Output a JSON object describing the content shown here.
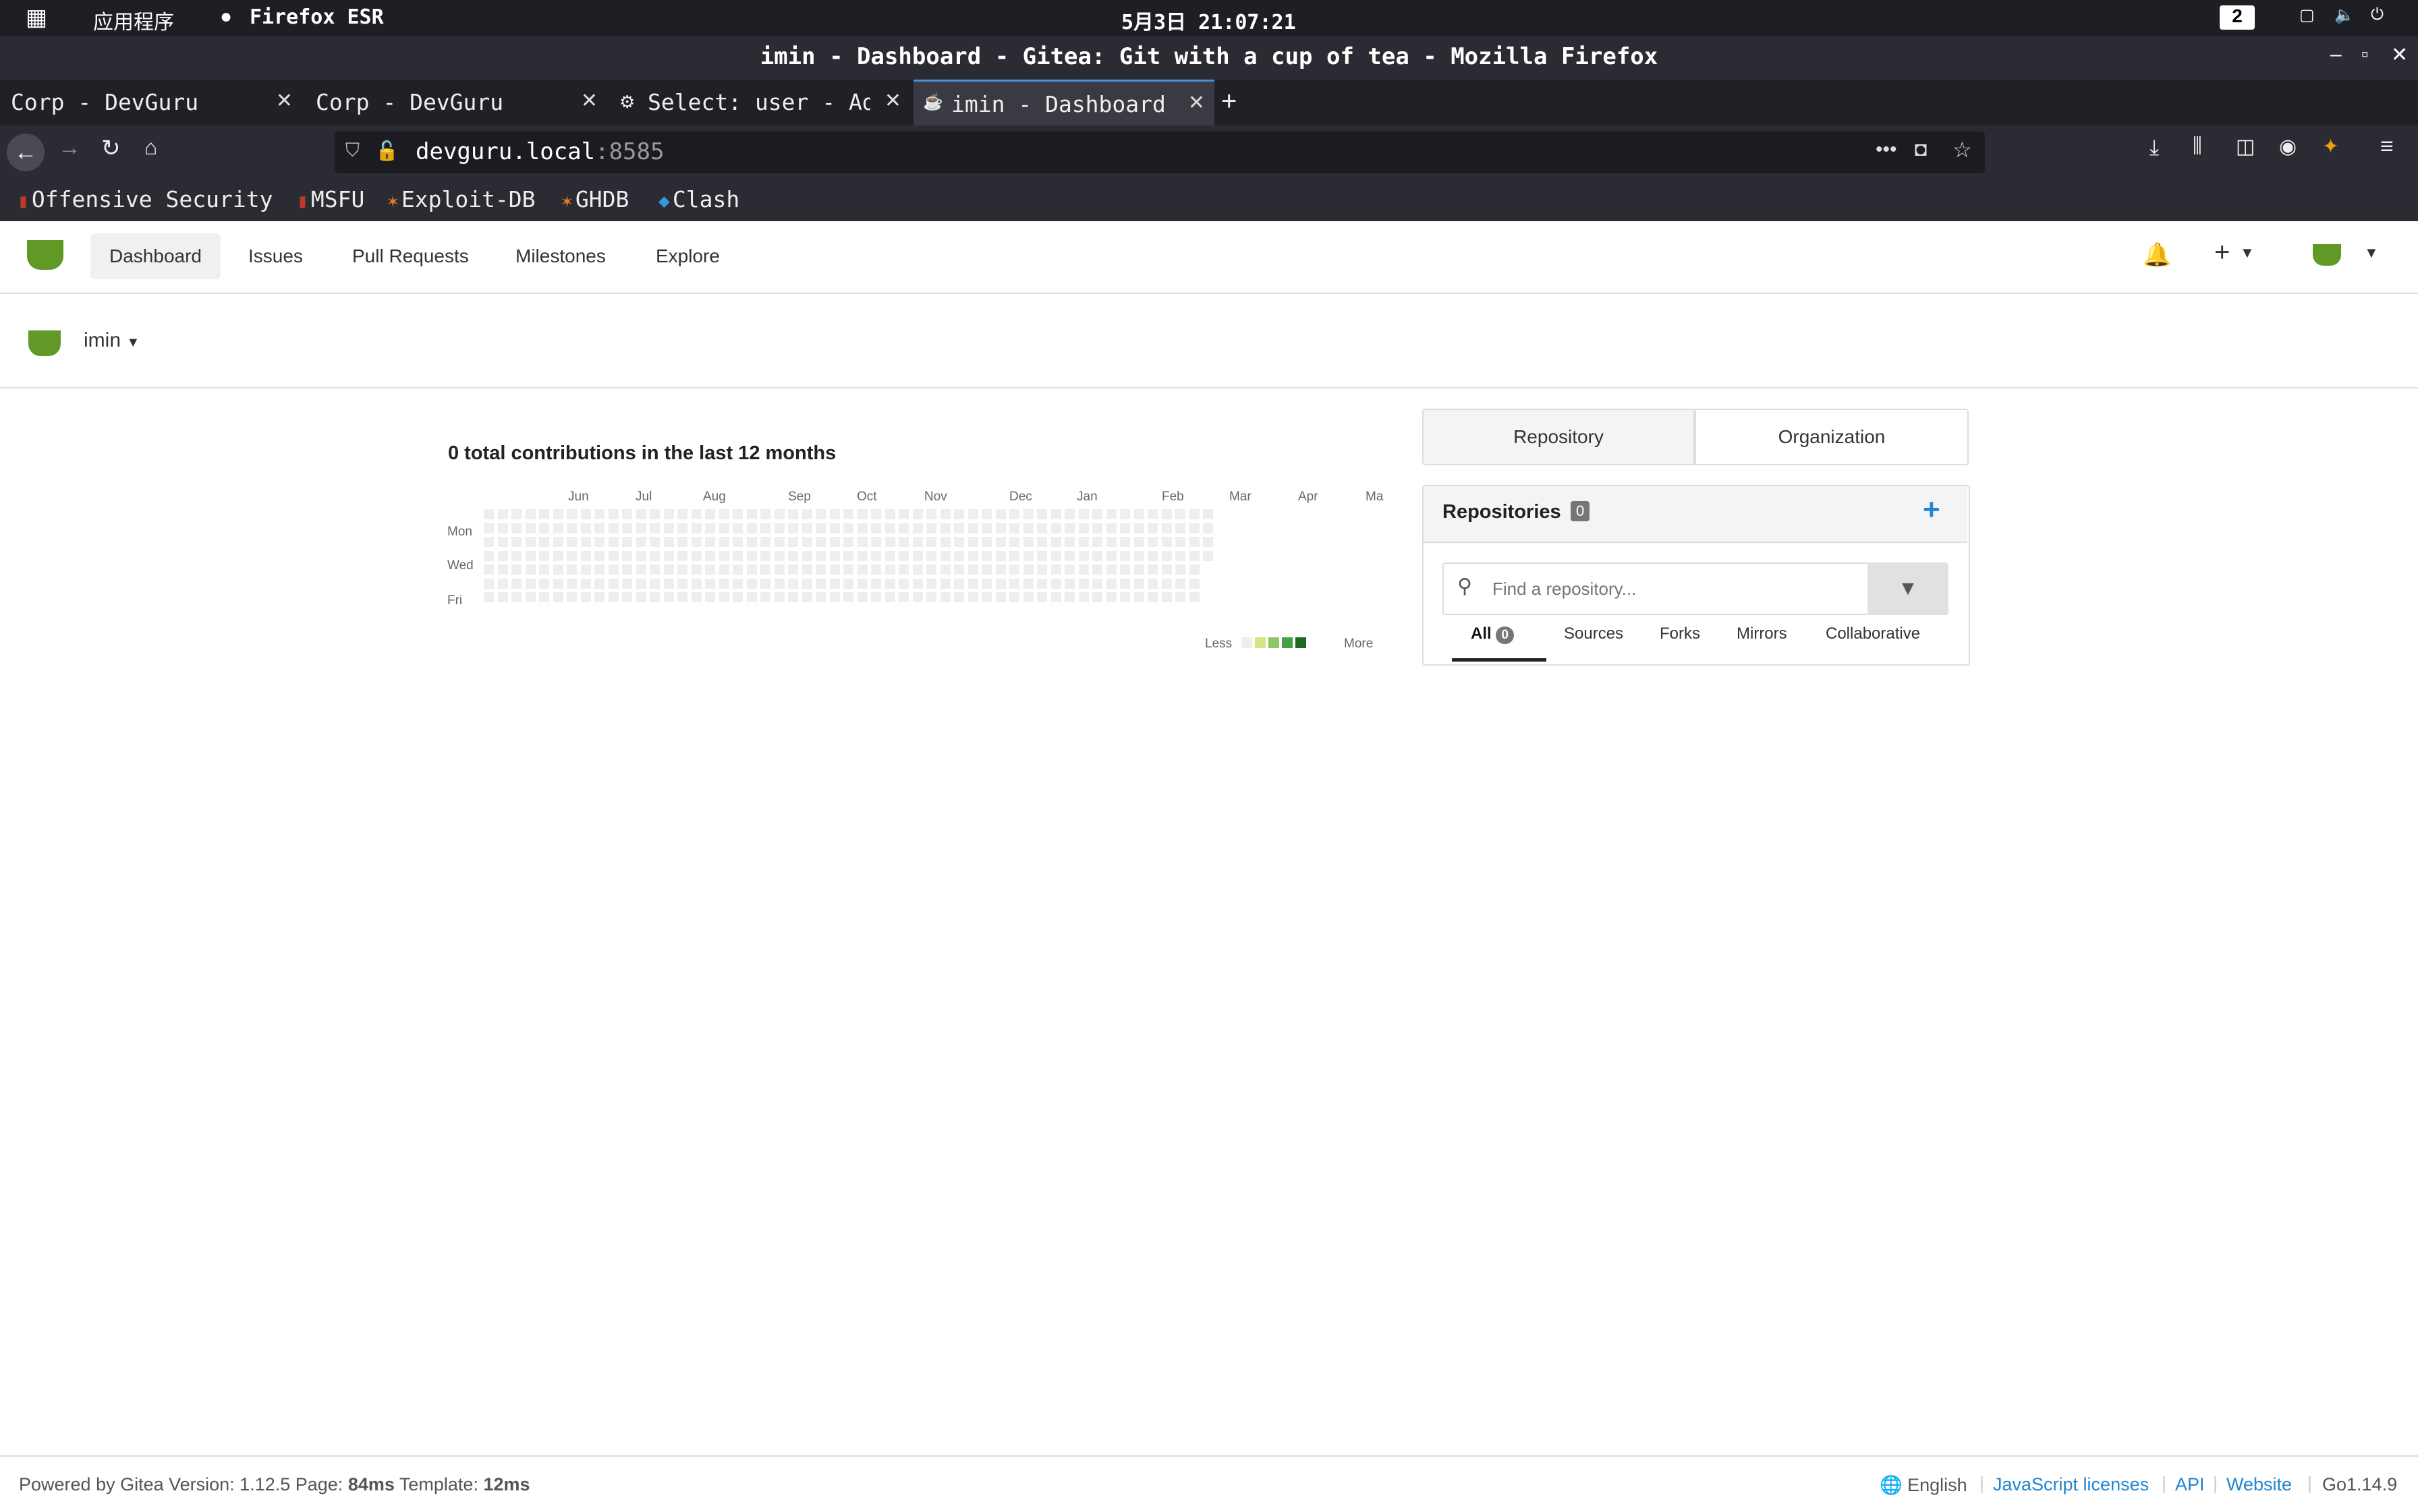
{
  "os": {
    "apps_label": "应用程序",
    "browser_label": "Firefox ESR",
    "clock": "5月3日 21:07:21",
    "workspace": "2"
  },
  "window": {
    "title": "imin - Dashboard - Gitea: Git with a cup of tea - Mozilla Firefox"
  },
  "tabs": [
    {
      "label": "Corp - DevGuru"
    },
    {
      "label": "Corp - DevGuru"
    },
    {
      "label": "Select: user - Ad"
    },
    {
      "label": "imin - Dashboard",
      "active": true
    }
  ],
  "url": {
    "host": "devguru.local",
    "port": ":8585"
  },
  "bookmarks": [
    "Offensive Security",
    "MSFU",
    "Exploit-DB",
    "GHDB",
    "Clash"
  ],
  "gitea": {
    "nav": [
      "Dashboard",
      "Issues",
      "Pull Requests",
      "Milestones",
      "Explore"
    ],
    "context_user": "imin",
    "contrib_title": "0 total contributions in the last 12 months",
    "months": [
      "Jun",
      "Jul",
      "Aug",
      "Sep",
      "Oct",
      "Nov",
      "Dec",
      "Jan",
      "Feb",
      "Mar",
      "Apr",
      "Ma"
    ],
    "days": [
      "Mon",
      "Wed",
      "Fri"
    ],
    "legend_less": "Less",
    "legend_more": "More",
    "legend_colors": [
      "#eeeeee",
      "#d6e685",
      "#8cc665",
      "#44a340",
      "#1e6823"
    ],
    "switch": [
      "Repository",
      "Organization"
    ],
    "repos_title": "Repositories",
    "repos_count": "0",
    "search_placeholder": "Find a repository...",
    "repo_tabs": [
      "All",
      "Sources",
      "Forks",
      "Mirrors",
      "Collaborative"
    ],
    "all_count": "0"
  },
  "footer": {
    "powered": "Powered by Gitea Version: 1.12.5 Page: ",
    "page_ms": "84ms",
    "template_label": " Template: ",
    "template_ms": "12ms",
    "lang": "English",
    "links": [
      "JavaScript licenses",
      "API",
      "Website"
    ],
    "go": "Go1.14.9"
  },
  "colors": {
    "accent": "#4a90d9",
    "gitea_green": "#609926",
    "link": "#2185d0"
  }
}
